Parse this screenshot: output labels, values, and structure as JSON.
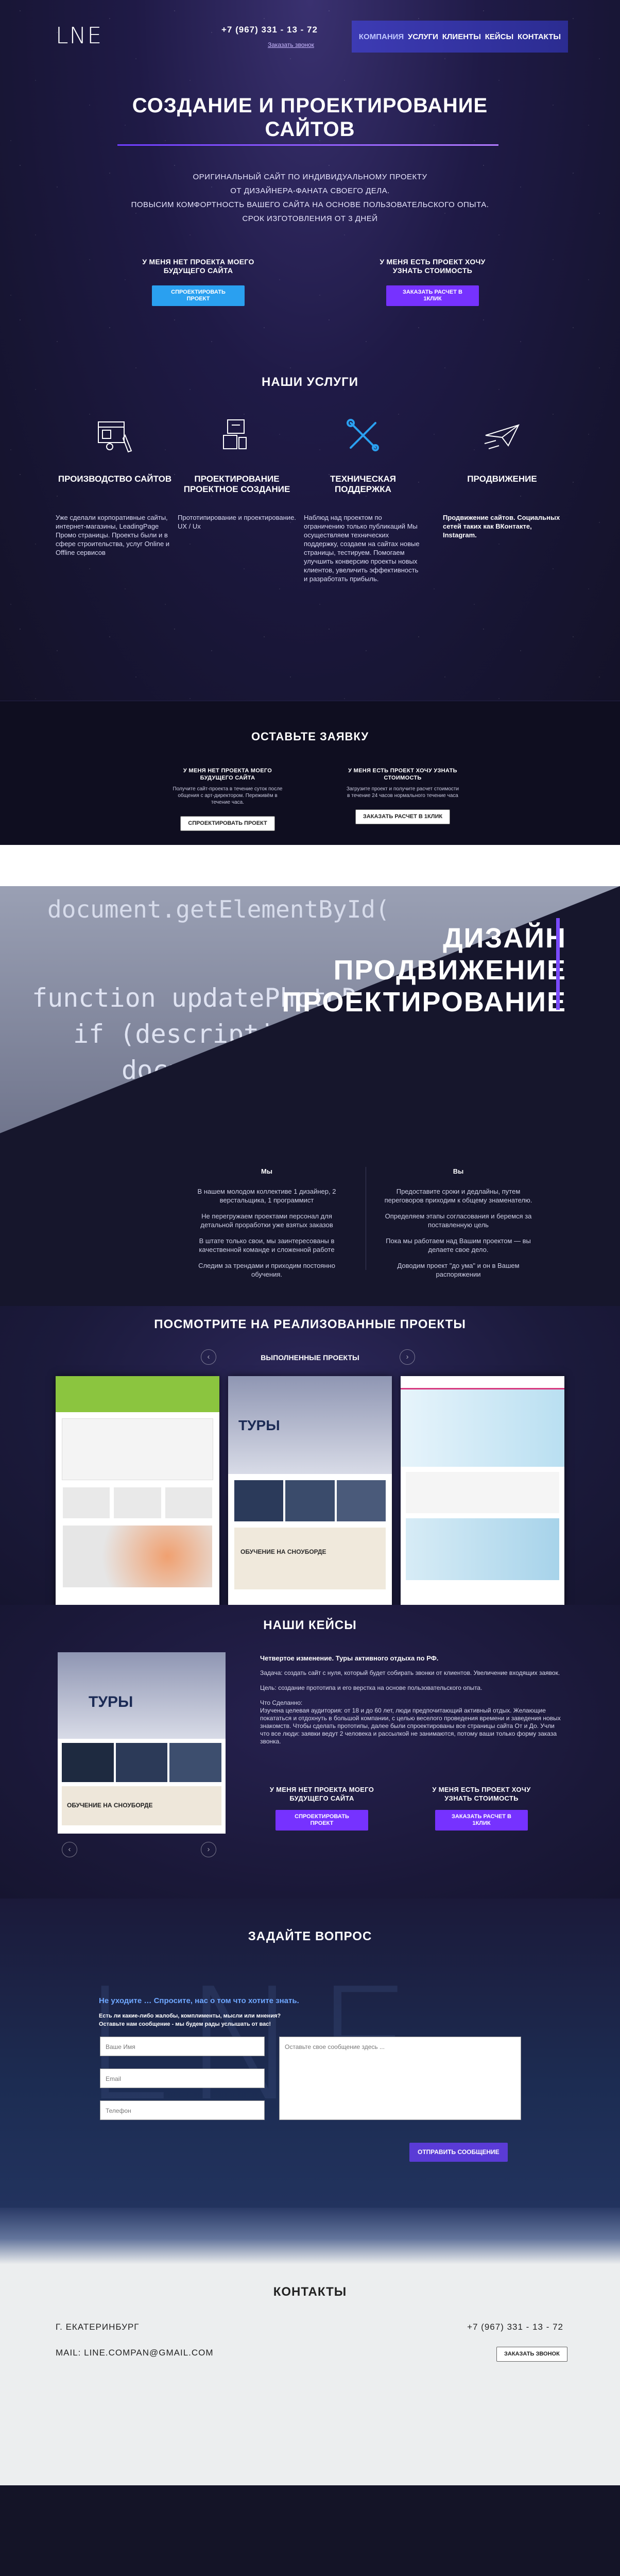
{
  "header": {
    "logo": "LNE",
    "phone": "+7 (967) 331 - 13 - 72",
    "call_link": "Заказать звонок",
    "nav": [
      "Компания",
      "Услуги",
      "Клиенты",
      "Кейсы",
      "Контакты"
    ]
  },
  "hero": {
    "title_line1": "СОЗДАНИЕ И ПРОЕКТИРОВАНИЕ",
    "title_line2": "САЙТОВ",
    "lead": [
      "ОРИГИНАЛЬНЫЙ САЙТ ПО ИНДИВИДУАЛЬНОМУ ПРОЕКТУ",
      "ОТ ДИЗАЙНЕРА-ФАНАТА СВОЕГО ДЕЛА.",
      "ПОВЫСИМ КОМФОРТНОСТЬ ВАШЕГО САЙТА НА ОСНОВЕ ПОЛЬЗОВАТЕЛЬСКОГО ОПЫТА.",
      "СРОК ИЗГОТОВЛЕНИЯ ОТ 3 ДНЕЙ"
    ],
    "cta_left": {
      "title": "У МЕНЯ НЕТ ПРОЕКТА МОЕГО БУДУЩЕГО САЙТА",
      "button": "СПРОЕКТИРОВАТЬ ПРОЕКТ"
    },
    "cta_right": {
      "title": "У МЕНЯ ЕСТЬ ПРОЕКТ ХОЧУ УЗНАТЬ СТОИМОСТЬ",
      "button": "ЗАКАЗАТЬ РАСЧЕТ В 1КЛИК"
    }
  },
  "services": {
    "title": "НАШИ УСЛУГИ",
    "items": [
      {
        "name": "ПРОИЗВОДСТВО САЙТОВ",
        "desc": "Уже сделали корпоративные сайты, интернет-магазины, LeadingPage Промо страницы. Проекты были и в сфере строительства, услуг Online и Offline сервисов"
      },
      {
        "name": "ПРОЕКТИРОВАНИЕ ПРОЕКТНОЕ СОЗДАНИЕ",
        "desc": "Прототипирование и проектирование. UX / Ux"
      },
      {
        "name": "ТЕХНИЧЕСКАЯ ПОДДЕРЖКА",
        "desc": "Наблюд над проектом по ограничению только публикаций Мы осуществляем технических поддержку, создаем на сайтах новые страницы, тестируем. Помогаем улучшить конверсию проекты новых клиентов, увеличить эффективность и разработать прибыль."
      },
      {
        "name": "ПРОДВИЖЕНИЕ",
        "desc": "Продвижение сайтов. Социальных сетей таких как ВКонтакте, Instagram."
      }
    ]
  },
  "request": {
    "title": "ОСТАВЬТЕ ЗАЯВКУ",
    "left": {
      "title": "У МЕНЯ НЕТ ПРОЕКТА МОЕГО БУДУЩЕГО САЙТА",
      "desc": "Получите сайт-проекта в течение суток после общения с арт-директором. Переживём в течение часа.",
      "button": "СПРОЕКТИРОВАТЬ ПРОЕКТ"
    },
    "right": {
      "title": "У МЕНЯ ЕСТЬ ПРОЕКТ ХОЧУ УЗНАТЬ СТОИМОСТЬ",
      "desc": "Загрузите проект и получите расчет стоимости в течение 24 часов нормального течение часа",
      "button": "ЗАКАЗАТЬ РАСЧЕТ В 1КЛИК"
    }
  },
  "code": {
    "lines": [
      "document.getElementById(",
      "function updatePhotoDesc",
      "if (descriptions.le",
      "document"
    ],
    "big": [
      "ДИЗАЙН",
      "ПРОДВИЖЕНИЕ",
      "ПРОЕКТИРОВАНИЕ"
    ],
    "we": {
      "title": "Мы",
      "items": [
        "В нашем молодом коллективе 1 дизайнер, 2 верстальщика, 1 программист",
        "Не перегружаем проектами персонал для детальной проработки уже взятых заказов",
        "В штате только свои, мы заинтересованы в качественной командe и сложенной работе",
        "Следим за трендами и приходим постоянно обучения."
      ]
    },
    "you": {
      "title": "Вы",
      "items": [
        "Предоставите сроки и дедлайны, путем переговоров приходим к общему знаменателю.",
        "Определяем этапы согласования и беремся за поставленную цель",
        "Пока мы работаем над Вашим проектом — вы делаете свое дело.",
        "Доводим проект \"до ума\" и он в Вашем распоряжении"
      ]
    }
  },
  "projects": {
    "title": "ПОСМОТРИТЕ НА РЕАЛИЗОВАННЫЕ ПРОЕКТЫ",
    "subtitle": "ВЫПОЛНЕННЫЕ ПРОЕКТЫ",
    "thumb_tours": "ТУРЫ",
    "thumb_training": "ОБУЧЕНИЕ НА СНОУБОРДЕ",
    "prev": "‹",
    "next": "›"
  },
  "cases": {
    "title": "НАШИ КЕЙСЫ",
    "case_title": "Четвертое изменение. Туры активного отдыха по РФ.",
    "task": "Задача: создать сайт с нуля, который будет собирать звонки от клиентов. Увеличение входящих заявок.",
    "goal": "Цель: создание прототипа и его верстка на основе пользовательского опыта.",
    "done_title": "Что Сделанно:",
    "done": "Изучена целевая аудитория: от 18 и до 60 лет, люди предпочитающий активный отдых. Желающие покататься и отдохнуть в большой компании, с целью веселого проведения времени и заведения новых знакомств. Чтобы сделать прототипы, далее были спроектированы все страницы сайта От и До. Учли что все люди: заявки ведут 2 человека и рассылкой не занимаются, потому ваши только форму заказа звонка.",
    "cta_left": {
      "title": "У МЕНЯ НЕТ ПРОЕКТА МОЕГО БУДУЩЕГО САЙТА",
      "button": "СПРОЕКТИРОВАТЬ ПРОЕКТ"
    },
    "cta_right": {
      "title": "У МЕНЯ ЕСТЬ ПРОЕКТ ХОЧУ УЗНАТЬ СТОИМОСТЬ",
      "button": "ЗАКАЗАТЬ РАСЧЕТ В 1КЛИК"
    }
  },
  "question": {
    "title": "ЗАДАЙТЕ ВОПРОС",
    "intro": "Не уходите … Спросите, нас о том что хотите знать.",
    "sub1": "Есть ли какие-либо жалобы, комплименты, мысли или мнения?",
    "sub2": "Оставьте нам сообщение - мы будем рады услышать от вас!",
    "name_ph": "Ваше Имя",
    "email_ph": "Email",
    "phone_ph": "Телефон",
    "msg_ph": "Оставьте свое сообщение здесь ...",
    "submit": "ОТПРАВИТЬ СООБЩЕНИЕ"
  },
  "contacts": {
    "title": "КОНТАКТЫ",
    "city": "Г. ЕКАТЕРИНБУРГ",
    "phone": "+7 (967) 331 - 13 - 72",
    "mail": "MAIL: LINE.COMPAN@GMAIL.COM",
    "call_button": "ЗАКАЗАТЬ ЗВОНОК"
  }
}
